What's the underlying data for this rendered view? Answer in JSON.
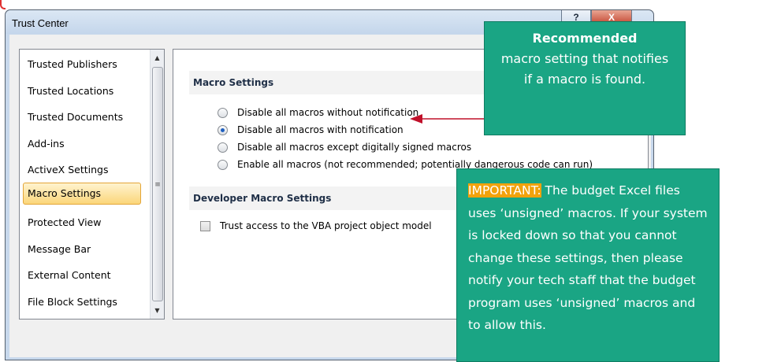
{
  "window": {
    "title": "Trust Center",
    "help_glyph": "?",
    "close_glyph": "X"
  },
  "nav": {
    "items": [
      "Trusted Publishers",
      "Trusted Locations",
      "Trusted Documents",
      "Add-ins",
      "ActiveX Settings",
      "Macro Settings",
      "Protected View",
      "Message Bar",
      "External Content",
      "File Block Settings"
    ],
    "selected": "Macro Settings"
  },
  "macro_settings": {
    "header": "Macro Settings",
    "options": [
      {
        "label": "Disable all macros without notification",
        "checked": false
      },
      {
        "label": "Disable all macros with notification",
        "checked": true
      },
      {
        "label": "Disable all macros except digitally signed macros",
        "checked": false
      },
      {
        "label": "Enable all macros (not recommended; potentially dangerous code can run)",
        "checked": false
      }
    ]
  },
  "developer_settings": {
    "header": "Developer Macro Settings",
    "checkbox_label": "Trust access to the VBA project object model",
    "checked": false
  },
  "callouts": {
    "recommended_title": "Recommended",
    "recommended_text": "macro setting that notifies if a macro is found.",
    "important_label": "IMPORTANT:",
    "important_text": " The budget Excel files uses ‘unsigned’ macros.  If your system is locked down so that you cannot change these settings, then please notify your tech staff that the budget program uses ‘unsigned’ macros and to allow this."
  },
  "colors": {
    "callout_bg": "#1aa584",
    "important_highlight": "#f2a20c",
    "arrow": "#c0102a",
    "selection": "#fbd67a"
  }
}
